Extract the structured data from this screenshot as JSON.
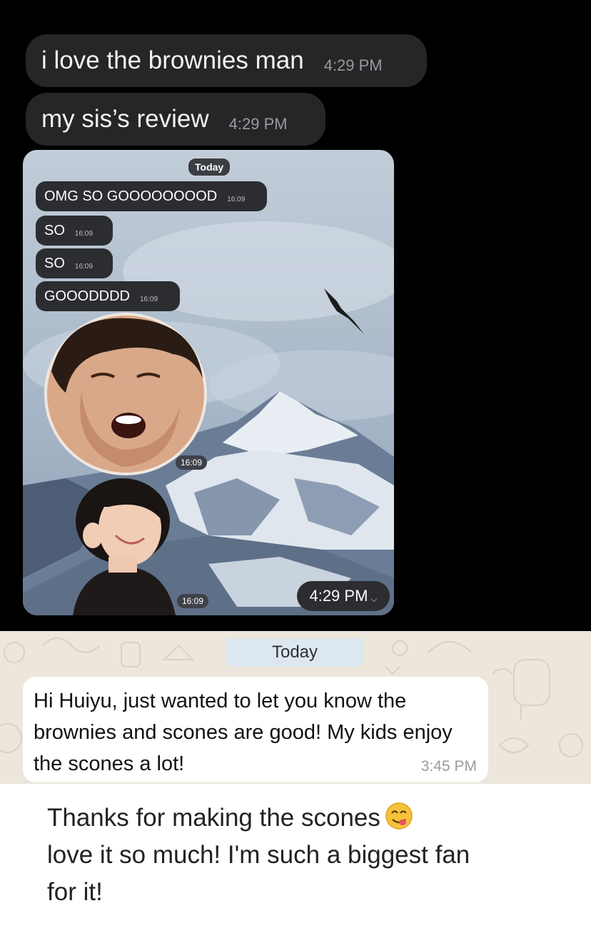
{
  "dark_chat": {
    "messages": [
      {
        "text": "i love the brownies man",
        "time": "4:29 PM"
      },
      {
        "text": "my sis’s review",
        "time": "4:29 PM"
      }
    ],
    "embedded_screenshot": {
      "date_pill": "Today",
      "messages": [
        {
          "text": "OMG SO GOOOOOOOOD",
          "time": "16:09"
        },
        {
          "text": "SO",
          "time": "16:09"
        },
        {
          "text": "SO",
          "time": "16:09"
        },
        {
          "text": "GOOODDDD",
          "time": "16:09"
        }
      ],
      "sticker_times": [
        "16:09",
        "16:09"
      ],
      "sent_time": "4:29 PM"
    }
  },
  "whatsapp": {
    "date_divider": "Today",
    "message": {
      "text": "Hi Huiyu, just wanted to let you know the brownies and scones are good! My kids enjoy the scones a lot!",
      "time": "3:45 PM"
    }
  },
  "caption": {
    "text": "Thanks for making the scones",
    "emoji": "face-savoring-food-icon",
    "text_after": "love it so much! I'm such a biggest fan for it!"
  }
}
